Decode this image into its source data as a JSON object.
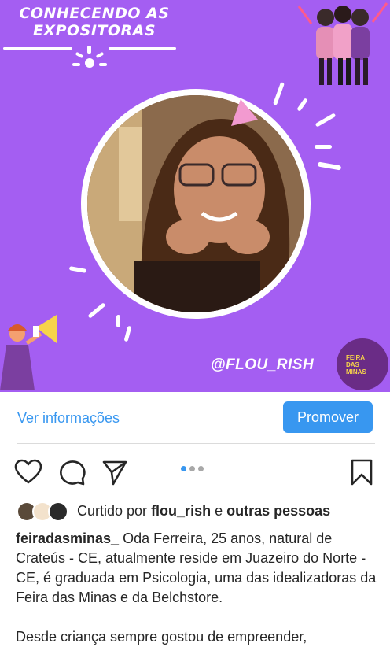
{
  "post_image": {
    "heading_line1": "CONHECENDO AS",
    "heading_line2": "EXPOSITORAS",
    "handle": "@FLOU_RISH",
    "logo_line1": "FEIRA",
    "logo_line2": "DAS",
    "logo_line3": "MINAS",
    "background_color": "#a45ef2",
    "logo_color": "#6a2c86"
  },
  "info_bar": {
    "view_info_label": "Ver informações",
    "promote_label": "Promover",
    "accent_color": "#3897f0"
  },
  "actions": {
    "like_icon": "heart-icon",
    "comment_icon": "comment-icon",
    "share_icon": "send-icon",
    "save_icon": "bookmark-icon",
    "carousel_total": 3,
    "carousel_active": 1
  },
  "likes": {
    "prefix": "Curtido por",
    "user": "flou_rish",
    "connector": "e",
    "others": "outras pessoas"
  },
  "caption": {
    "username": "feiradasminas_",
    "text": " Oda Ferreira, 25 anos, natural de Crateús - CE, atualmente reside em Juazeiro do Norte - CE, é graduada em Psicologia, uma das idealizadoras da Feira das Minas e da Belchstore.",
    "second_paragraph": "Desde criança sempre gostou de empreender,"
  }
}
